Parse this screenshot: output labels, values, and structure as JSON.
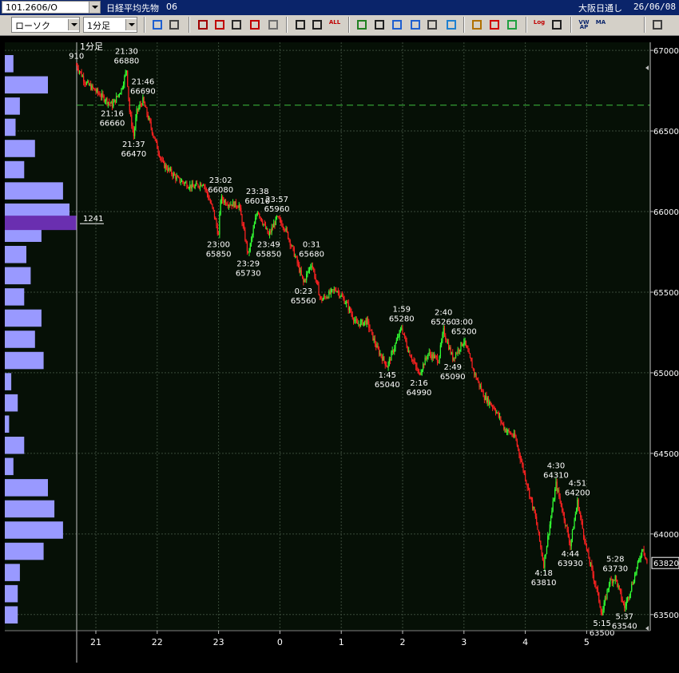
{
  "header": {
    "symbol": "101.2606/O",
    "instrument": "日経平均先物",
    "instrument_code": "06",
    "session": "大阪日通し",
    "date": "26/06/08"
  },
  "toolbar": {
    "chart_type": "ローソク",
    "timeframe": "1分足",
    "buttons": [
      {
        "name": "zoom-icon",
        "color": "#1e5fd0"
      },
      {
        "name": "crosshair-icon",
        "color": "#444444"
      },
      {
        "name": "download-icon",
        "color": "#a00000"
      },
      {
        "name": "search-chart-icon",
        "color": "#c00000"
      },
      {
        "name": "trend-icon",
        "color": "#2a2a2a"
      },
      {
        "name": "arrows-icon",
        "color": "#c00000"
      },
      {
        "name": "warning-icon",
        "color": "#707070"
      },
      {
        "name": "candle-icon",
        "color": "#202020"
      },
      {
        "name": "candle-settings-icon",
        "color": "#202020"
      },
      {
        "name": "all-icon",
        "color": "#c00000",
        "text": "ALL"
      },
      {
        "name": "pen-icon",
        "color": "#208020"
      },
      {
        "name": "line-tool-icon",
        "color": "#202020"
      },
      {
        "name": "cursor-icon",
        "color": "#1e5fd0"
      },
      {
        "name": "undo-icon",
        "color": "#1e5fd0"
      },
      {
        "name": "note-icon",
        "color": "#404040"
      },
      {
        "name": "trash-icon",
        "color": "#1e80d0"
      },
      {
        "name": "pattern-icon",
        "color": "#b07000"
      },
      {
        "name": "wrench-icon",
        "color": "#d00000"
      },
      {
        "name": "rainbow-icon",
        "color": "#20a040"
      },
      {
        "name": "log-icon",
        "color": "#c00000",
        "text": "Log"
      },
      {
        "name": "panel-icon",
        "color": "#202020"
      },
      {
        "name": "vwap-icon",
        "color": "#0a246a",
        "text": "VW AP"
      },
      {
        "name": "ma-icon",
        "color": "#0a246a",
        "text": "MA"
      },
      {
        "name": "layout-icon",
        "color": "#404040"
      }
    ]
  },
  "chart_data": {
    "type": "candlestick",
    "title": "1分足",
    "y_range": [
      63400,
      67050
    ],
    "y_ticks": [
      63500,
      64000,
      64500,
      65000,
      65500,
      66000,
      66500,
      67000
    ],
    "x_ticks": [
      "21",
      "22",
      "23",
      "0",
      "1",
      "2",
      "3",
      "4",
      "5"
    ],
    "grid": true,
    "current_price": 63820,
    "previous_close": 66660,
    "volume_profile_highlight": "1241",
    "volume_profile": [
      0.04,
      0.2,
      0.07,
      0.05,
      0.14,
      0.09,
      0.27,
      0.3,
      0.17,
      0.1,
      0.12,
      0.09,
      0.17,
      0.14,
      0.18,
      0.03,
      0.06,
      0.02,
      0.09,
      0.04,
      0.2,
      0.23,
      0.27,
      0.18,
      0.07,
      0.06,
      0.06
    ],
    "path": [
      [
        "20:41",
        66910
      ],
      [
        "20:50",
        66800
      ],
      [
        "21:05",
        66720
      ],
      [
        "21:16",
        66660
      ],
      [
        "21:25",
        66760
      ],
      [
        "21:30",
        66880
      ],
      [
        "21:33",
        66620
      ],
      [
        "21:37",
        66470
      ],
      [
        "21:40",
        66620
      ],
      [
        "21:46",
        66690
      ],
      [
        "21:55",
        66500
      ],
      [
        "22:05",
        66300
      ],
      [
        "22:20",
        66200
      ],
      [
        "22:35",
        66150
      ],
      [
        "22:45",
        66180
      ],
      [
        "22:55",
        66000
      ],
      [
        "23:00",
        65850
      ],
      [
        "23:02",
        66080
      ],
      [
        "23:10",
        66050
      ],
      [
        "23:20",
        66040
      ],
      [
        "23:29",
        65730
      ],
      [
        "23:38",
        66010
      ],
      [
        "23:49",
        65850
      ],
      [
        "23:57",
        65960
      ],
      [
        "0:05",
        65900
      ],
      [
        "0:15",
        65720
      ],
      [
        "0:23",
        65560
      ],
      [
        "0:31",
        65680
      ],
      [
        "0:40",
        65450
      ],
      [
        "0:55",
        65520
      ],
      [
        "1:05",
        65430
      ],
      [
        "1:15",
        65300
      ],
      [
        "1:25",
        65320
      ],
      [
        "1:35",
        65150
      ],
      [
        "1:45",
        65040
      ],
      [
        "1:59",
        65280
      ],
      [
        "2:05",
        65150
      ],
      [
        "2:16",
        64990
      ],
      [
        "2:25",
        65120
      ],
      [
        "2:35",
        65080
      ],
      [
        "2:40",
        65260
      ],
      [
        "2:49",
        65090
      ],
      [
        "3:00",
        65200
      ],
      [
        "3:10",
        65000
      ],
      [
        "3:20",
        64850
      ],
      [
        "3:30",
        64780
      ],
      [
        "3:40",
        64650
      ],
      [
        "3:50",
        64600
      ],
      [
        "4:00",
        64350
      ],
      [
        "4:10",
        64100
      ],
      [
        "4:18",
        63810
      ],
      [
        "4:30",
        64310
      ],
      [
        "4:38",
        64100
      ],
      [
        "4:44",
        63930
      ],
      [
        "4:51",
        64200
      ],
      [
        "5:00",
        63900
      ],
      [
        "5:10",
        63650
      ],
      [
        "5:15",
        63500
      ],
      [
        "5:22",
        63700
      ],
      [
        "5:28",
        63730
      ],
      [
        "5:37",
        63540
      ],
      [
        "5:45",
        63700
      ],
      [
        "5:55",
        63920
      ],
      [
        "5:59",
        63820
      ]
    ],
    "annotations": [
      {
        "time": "20:41",
        "label": "910",
        "pos": "above"
      },
      {
        "time": "21:16",
        "label": "21:16",
        "value": "66660",
        "pos": "below"
      },
      {
        "time": "21:30",
        "label": "21:30",
        "value": "66880",
        "pos": "above"
      },
      {
        "time": "21:37",
        "label": "21:37",
        "value": "66470",
        "pos": "below"
      },
      {
        "time": "21:46",
        "label": "21:46",
        "value": "66690",
        "pos": "above"
      },
      {
        "time": "23:00",
        "label": "23:00",
        "value": "65850",
        "pos": "below"
      },
      {
        "time": "23:02",
        "label": "23:02",
        "value": "66080",
        "pos": "above"
      },
      {
        "time": "23:29",
        "label": "23:29",
        "value": "65730",
        "pos": "below"
      },
      {
        "time": "23:38",
        "label": "23:38",
        "value": "66010",
        "pos": "above"
      },
      {
        "time": "23:49",
        "label": "23:49",
        "value": "65850",
        "pos": "below"
      },
      {
        "time": "23:57",
        "label": "23:57",
        "value": "65960",
        "pos": "above"
      },
      {
        "time": "0:23",
        "label": "0:23",
        "value": "65560",
        "pos": "below"
      },
      {
        "time": "0:31",
        "label": "0:31",
        "value": "65680",
        "pos": "above"
      },
      {
        "time": "1:45",
        "label": "1:45",
        "value": "65040",
        "pos": "below"
      },
      {
        "time": "1:59",
        "label": "1:59",
        "value": "65280",
        "pos": "above"
      },
      {
        "time": "2:16",
        "label": "2:16",
        "value": "64990",
        "pos": "below"
      },
      {
        "time": "2:40",
        "label": "2:40",
        "value": "65260",
        "pos": "above"
      },
      {
        "time": "2:49",
        "label": "2:49",
        "value": "65090",
        "pos": "below"
      },
      {
        "time": "3:00",
        "label": "3:00",
        "value": "65200",
        "pos": "above"
      },
      {
        "time": "4:18",
        "label": "4:18",
        "value": "63810",
        "pos": "below"
      },
      {
        "time": "4:30",
        "label": "4:30",
        "value": "64310",
        "pos": "above"
      },
      {
        "time": "4:44",
        "label": "4:44",
        "value": "63930",
        "pos": "below"
      },
      {
        "time": "4:51",
        "label": "4:51",
        "value": "64200",
        "pos": "above"
      },
      {
        "time": "5:15",
        "label": "5:15",
        "value": "63500",
        "pos": "below"
      },
      {
        "time": "5:28",
        "label": "5:28",
        "value": "63730",
        "pos": "above"
      },
      {
        "time": "5:37",
        "label": "5:37",
        "value": "63540",
        "pos": "below"
      }
    ],
    "colors": {
      "up": "#33ff33",
      "down": "#ff2222",
      "profile": "#9999ff",
      "profile_highlight": "#6a2fb0",
      "grid": "#3a4a3a",
      "background": "#000000",
      "plot_bg": "#061006"
    }
  }
}
